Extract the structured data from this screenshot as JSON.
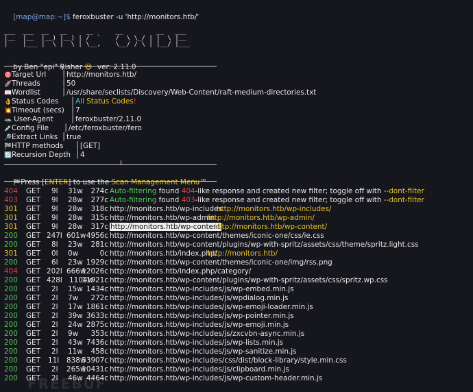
{
  "prompt": {
    "user": "[map@map:~]$",
    "command": "feroxbuster -u 'http://monitors.htb/'"
  },
  "banner": {
    "art": [
      "___  ___  __   __     __      __         __   ___",
      "|__  |__  |__) |__) | /  `    /  \\ \\_/ | |  \\ |__",
      "|    |___ |  \\ |  \\ | \\__,    \\__/ / \\ | |__/ |___"
    ],
    "author": "by Ben \"epi\" Risher",
    "author_emoji": "😃",
    "version": "ver: 2.11.0"
  },
  "config": [
    {
      "icon": "🎯",
      "key": "Target Url",
      "value": "http://monitors.htb/"
    },
    {
      "icon": "🚀",
      "key": "Threads",
      "value": "50"
    },
    {
      "icon": "📖",
      "key": "Wordlist",
      "value": "/usr/share/seclists/Discovery/Web-Content/raft-medium-directories.txt"
    },
    {
      "icon": "👌",
      "key": "Status Codes",
      "value_parts": [
        {
          "text": "All",
          "color": "cyan"
        },
        {
          "text": " Status Codes",
          "color": "yellow"
        },
        {
          "text": "!",
          "color": "red"
        }
      ]
    },
    {
      "icon": "💥",
      "key": "Timeout (secs)",
      "value": "7"
    },
    {
      "icon": "🦡",
      "key": "User-Agent",
      "value": "feroxbuster/2.11.0"
    },
    {
      "icon": "💉",
      "key": "Config File",
      "value": "/etc/feroxbuster/fero"
    },
    {
      "icon": "🔎",
      "key": "Extract Links",
      "value": "true"
    },
    {
      "icon": "🏁",
      "key": "HTTP methods",
      "value": "[GET]"
    },
    {
      "icon": "🔃",
      "key": "Recursion Depth",
      "value": "4"
    }
  ],
  "press_line": {
    "icon": "🏁",
    "prefix": "Press [",
    "key": "ENTER",
    "middle": "] to use the ",
    "menu": "Scan Management Menu",
    "suffix": "™"
  },
  "results": [
    {
      "status": "404",
      "method": "GET",
      "lines": "9l",
      "words": "31w",
      "chars": "274c",
      "parts": [
        {
          "text": "Auto-filtering",
          "color": "green"
        },
        {
          "text": " found ",
          "color": "white"
        },
        {
          "text": "404",
          "color": "red"
        },
        {
          "text": "-like response and created new filter; toggle off with ",
          "color": "white"
        },
        {
          "text": "--dont-filter",
          "color": "yellow"
        }
      ]
    },
    {
      "status": "403",
      "method": "GET",
      "lines": "9l",
      "words": "28w",
      "chars": "277c",
      "parts": [
        {
          "text": "Auto-filtering",
          "color": "green"
        },
        {
          "text": " found ",
          "color": "white"
        },
        {
          "text": "403",
          "color": "red"
        },
        {
          "text": "-like response and created new filter; toggle off with ",
          "color": "white"
        },
        {
          "text": "--dont-filter",
          "color": "yellow"
        }
      ]
    },
    {
      "status": "301",
      "method": "GET",
      "lines": "9l",
      "words": "28w",
      "chars": "318c",
      "url": "http://monitors.htb/wp-includes",
      "redirect": "http://monitors.htb/wp-includes/"
    },
    {
      "status": "301",
      "method": "GET",
      "lines": "9l",
      "words": "28w",
      "chars": "315c",
      "url": "http://monitors.htb/wp-admin",
      "redirect": "http://monitors.htb/wp-admin/"
    },
    {
      "status": "301",
      "method": "GET",
      "lines": "9l",
      "words": "28w",
      "chars": "317c",
      "url": "http://monitors.htb/wp-content",
      "redirect": "http://monitors.htb/wp-content/",
      "highlight": true
    },
    {
      "status": "200",
      "method": "GET",
      "lines": "247l",
      "words": "601w",
      "chars": "4956c",
      "url": "http://monitors.htb/wp-content/themes/iconic-one/css/ie.css"
    },
    {
      "status": "200",
      "method": "GET",
      "lines": "8l",
      "words": "23w",
      "chars": "281c",
      "url": "http://monitors.htb/wp-content/plugins/wp-with-spritz/assets/css/theme/spritz.light.css"
    },
    {
      "status": "301",
      "method": "GET",
      "lines": "0l",
      "words": "0w",
      "chars": "0c",
      "url": "http://monitors.htb/index.php/",
      "redirect": "http://monitors.htb/"
    },
    {
      "status": "200",
      "method": "GET",
      "lines": "6l",
      "words": "23w",
      "chars": "1929c",
      "url": "http://monitors.htb/wp-content/themes/iconic-one/img/rss.png"
    },
    {
      "status": "404",
      "method": "GET",
      "lines": "202l",
      "words": "666w",
      "chars": "12026c",
      "url": "http://monitors.htb/index.php/category/"
    },
    {
      "status": "200",
      "method": "GET",
      "lines": "428l",
      "words": "1104w",
      "chars": "11921c",
      "url": "http://monitors.htb/wp-content/plugins/wp-with-spritz/assets/css/spritz.wp.css"
    },
    {
      "status": "200",
      "method": "GET",
      "lines": "2l",
      "words": "15w",
      "chars": "1434c",
      "url": "http://monitors.htb/wp-includes/js/wp-embed.min.js"
    },
    {
      "status": "200",
      "method": "GET",
      "lines": "2l",
      "words": "7w",
      "chars": "272c",
      "url": "http://monitors.htb/wp-includes/js/wpdialog.min.js"
    },
    {
      "status": "200",
      "method": "GET",
      "lines": "2l",
      "words": "17w",
      "chars": "1861c",
      "url": "http://monitors.htb/wp-includes/js/wp-emoji-loader.min.js"
    },
    {
      "status": "200",
      "method": "GET",
      "lines": "2l",
      "words": "39w",
      "chars": "3633c",
      "url": "http://monitors.htb/wp-includes/js/wp-pointer.min.js"
    },
    {
      "status": "200",
      "method": "GET",
      "lines": "2l",
      "words": "24w",
      "chars": "2875c",
      "url": "http://monitors.htb/wp-includes/js/wp-emoji.min.js"
    },
    {
      "status": "200",
      "method": "GET",
      "lines": "2l",
      "words": "9w",
      "chars": "353c",
      "url": "http://monitors.htb/wp-includes/js/zxcvbn-async.min.js"
    },
    {
      "status": "200",
      "method": "GET",
      "lines": "2l",
      "words": "43w",
      "chars": "7436c",
      "url": "http://monitors.htb/wp-includes/js/wp-lists.min.js"
    },
    {
      "status": "200",
      "method": "GET",
      "lines": "2l",
      "words": "11w",
      "chars": "458c",
      "url": "http://monitors.htb/wp-includes/js/wp-sanitize.min.js"
    },
    {
      "status": "200",
      "method": "GET",
      "lines": "11l",
      "words": "838w",
      "chars": "53907c",
      "url": "http://monitors.htb/wp-includes/css/dist/block-library/style.min.css"
    },
    {
      "status": "200",
      "method": "GET",
      "lines": "2l",
      "words": "265w",
      "chars": "10431c",
      "url": "http://monitors.htb/wp-includes/js/clipboard.min.js"
    },
    {
      "status": "200",
      "method": "GET",
      "lines": "2l",
      "words": "46w",
      "chars": "4464c",
      "url": "http://monitors.htb/wp-includes/js/wp-custom-header.min.js"
    }
  ],
  "watermark": "FREEBUF",
  "colors": {
    "green": "#54c756",
    "red": "#e84040",
    "yellow": "#e6c229",
    "cyan": "#3ec0d8",
    "white": "#e8e8e8",
    "background": "#16161d"
  }
}
